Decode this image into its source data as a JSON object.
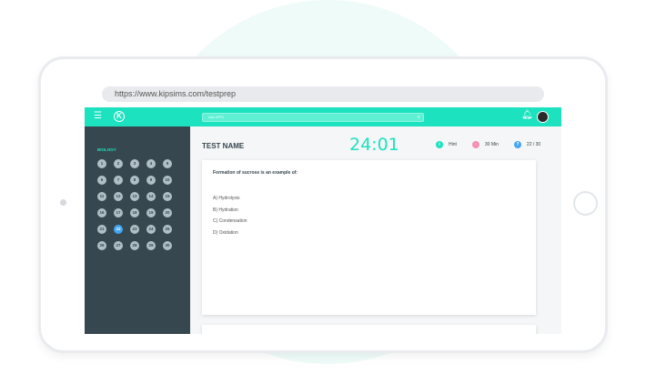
{
  "browser": {
    "url": "https://www.kipsims.com/testprep"
  },
  "header": {
    "search_placeholder": "Ask KIPS",
    "menu_icon": "menu-icon",
    "logo_icon": "kips-logo-icon"
  },
  "sidebar": {
    "subject": "BIOLOGY",
    "questions": [
      "1",
      "2",
      "3",
      "4",
      "5",
      "6",
      "7",
      "8",
      "9",
      "10",
      "11",
      "12",
      "13",
      "14",
      "15",
      "16",
      "17",
      "18",
      "19",
      "20",
      "21",
      "22",
      "23",
      "24",
      "25",
      "26",
      "27",
      "28",
      "29",
      "30"
    ],
    "active_question": "22"
  },
  "main": {
    "test_name": "TEST NAME",
    "timer": "24:01",
    "hint_label": "Hint",
    "time_limit": "30 Min",
    "progress": "22 / 30",
    "question": "Formation of sucrose is an example of:",
    "options": [
      "A) Hydrolysis",
      "B) Hydration",
      "C) Condensation",
      "D) Oxidation"
    ]
  },
  "colors": {
    "accent": "#1de2c0",
    "sidebar": "#37474f",
    "active": "#42a5f5",
    "pink": "#f48fb1"
  }
}
